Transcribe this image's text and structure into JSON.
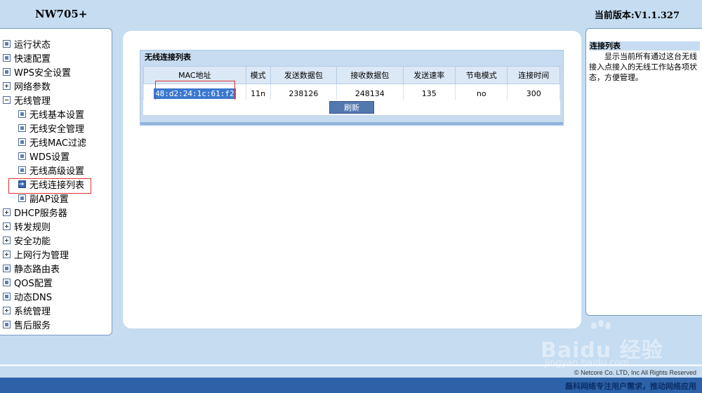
{
  "header": {
    "model": "NW705+",
    "version_label": "当前版本:",
    "version_value": "V1.1.327"
  },
  "sidebar": {
    "items": [
      {
        "label": "运行状态",
        "icon": "doc-icon"
      },
      {
        "label": "快速配置",
        "icon": "doc-icon"
      },
      {
        "label": "WPS安全设置",
        "icon": "doc-icon"
      },
      {
        "label": "网络参数",
        "icon": "plus-icon"
      },
      {
        "label": "无线管理",
        "icon": "minus-icon"
      },
      {
        "label": "无线基本设置",
        "icon": "doc-icon"
      },
      {
        "label": "无线安全管理",
        "icon": "doc-icon"
      },
      {
        "label": "无线MAC过滤",
        "icon": "doc-icon"
      },
      {
        "label": "WDS设置",
        "icon": "doc-icon"
      },
      {
        "label": "无线高级设置",
        "icon": "doc-icon"
      },
      {
        "label": "无线连接列表",
        "icon": "arrow-icon"
      },
      {
        "label": "副AP设置",
        "icon": "doc-icon"
      },
      {
        "label": "DHCP服务器",
        "icon": "plus-icon"
      },
      {
        "label": "转发规则",
        "icon": "plus-icon"
      },
      {
        "label": "安全功能",
        "icon": "plus-icon"
      },
      {
        "label": "上网行为管理",
        "icon": "plus-icon"
      },
      {
        "label": "静态路由表",
        "icon": "doc-icon"
      },
      {
        "label": "QOS配置",
        "icon": "doc-icon"
      },
      {
        "label": "动态DNS",
        "icon": "doc-icon"
      },
      {
        "label": "系统管理",
        "icon": "plus-icon"
      },
      {
        "label": "售后服务",
        "icon": "doc-icon"
      }
    ]
  },
  "main": {
    "panel_title": "无线连接列表",
    "columns": [
      "MAC地址",
      "模式",
      "发送数据包",
      "接收数据包",
      "发送速率",
      "节电模式",
      "连接时间"
    ],
    "rows": [
      {
        "mac": "48:d2:24:1c:61:f2",
        "mode": "11n",
        "tx_packets": "238126",
        "rx_packets": "248134",
        "tx_rate": "135",
        "power_save": "no",
        "conn_time": "300"
      }
    ],
    "refresh_label": "刷新"
  },
  "help": {
    "title": "连接列表",
    "body": "显示当前所有通过这台无线接入点接入的无线工作站各项状态，方便管理。"
  },
  "footer": {
    "copyright": "© Netcore Co. LTD, Inc  All Rights Reserved",
    "brand": "磊科网络",
    "slogan": "专注用户需求，推动网络应用"
  },
  "watermark": {
    "text": "Bai",
    "text2": "du",
    "text3": "经验",
    "sub": "jingyan.baidu.com"
  },
  "colors": {
    "background": "#c5dcf1",
    "accent": "#2d62a8",
    "selection": "#3b78d0",
    "highlight_border": "#dd3333"
  }
}
